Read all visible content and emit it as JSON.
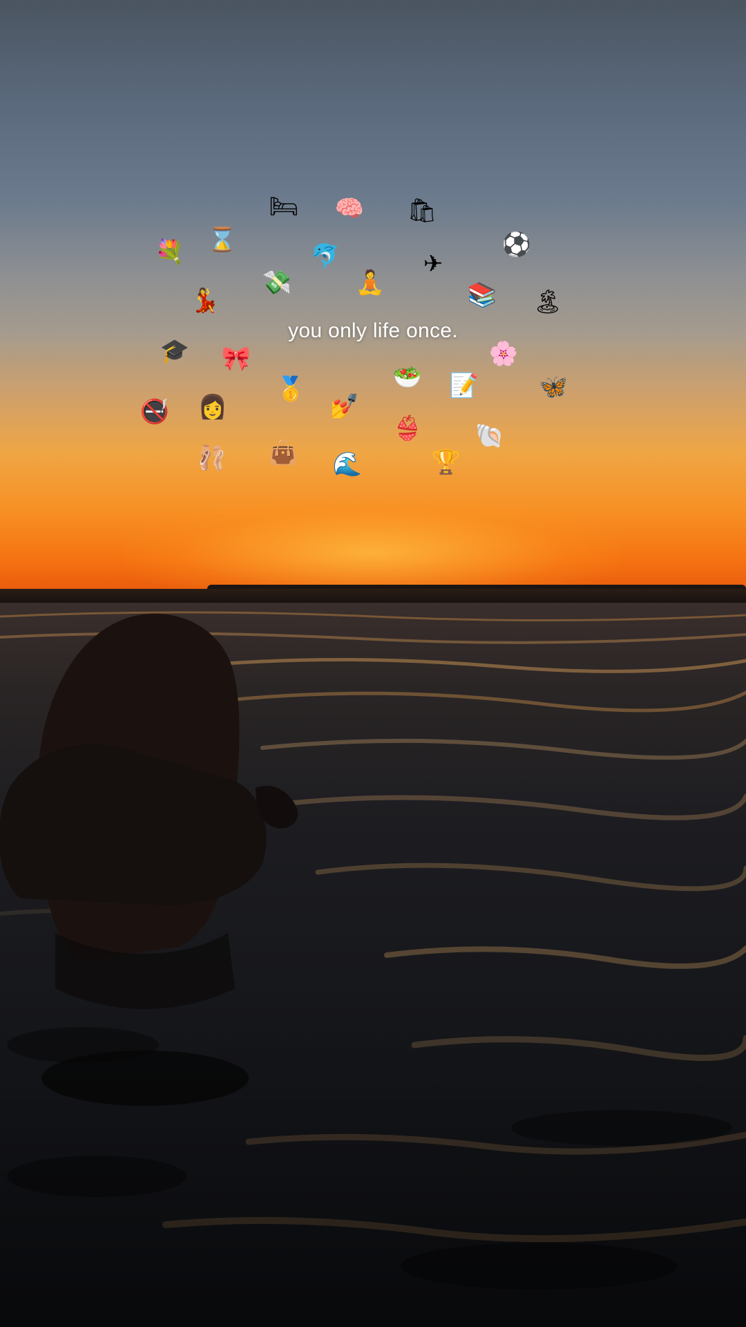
{
  "overlay": {
    "caption": "you only life once."
  },
  "stickers": [
    {
      "name": "bed-icon",
      "glyph": "🛏"
    },
    {
      "name": "brain-icon",
      "glyph": "🧠"
    },
    {
      "name": "shopping-bags-icon",
      "glyph": "🛍"
    },
    {
      "name": "soccer-ball-icon",
      "glyph": "⚽"
    },
    {
      "name": "flowers-bouquet-icon",
      "glyph": "💐"
    },
    {
      "name": "hourglass-icon",
      "glyph": "⌛"
    },
    {
      "name": "dolphin-icon",
      "glyph": "🐬"
    },
    {
      "name": "airplane-icon",
      "glyph": "✈"
    },
    {
      "name": "money-with-wings-icon",
      "glyph": "💸"
    },
    {
      "name": "meditating-woman-icon",
      "glyph": "🧘"
    },
    {
      "name": "books-icon",
      "glyph": "📚"
    },
    {
      "name": "dancing-woman-icon",
      "glyph": "💃"
    },
    {
      "name": "beach-umbrella-icon",
      "glyph": "🏝"
    },
    {
      "name": "graduation-cap-icon",
      "glyph": "🎓"
    },
    {
      "name": "pink-bow-icon",
      "glyph": "🎀"
    },
    {
      "name": "cherry-blossom-icon",
      "glyph": "🌸"
    },
    {
      "name": "salad-bowl-icon",
      "glyph": "🥗"
    },
    {
      "name": "memo-icon",
      "glyph": "📝"
    },
    {
      "name": "gold-medal-icon",
      "glyph": "🥇"
    },
    {
      "name": "butterfly-icon",
      "glyph": "🦋"
    },
    {
      "name": "no-smoking-icon",
      "glyph": "🚭"
    },
    {
      "name": "woman-teacher-icon",
      "glyph": "👩"
    },
    {
      "name": "nail-polish-icon",
      "glyph": "💅"
    },
    {
      "name": "bikini-icon",
      "glyph": "👙"
    },
    {
      "name": "spiral-shell-icon",
      "glyph": "🐚"
    },
    {
      "name": "ballet-shoes-icon",
      "glyph": "🩰"
    },
    {
      "name": "handbag-icon",
      "glyph": "👜"
    },
    {
      "name": "water-wave-icon",
      "glyph": "🌊"
    },
    {
      "name": "trophy-icon",
      "glyph": "🏆"
    }
  ]
}
